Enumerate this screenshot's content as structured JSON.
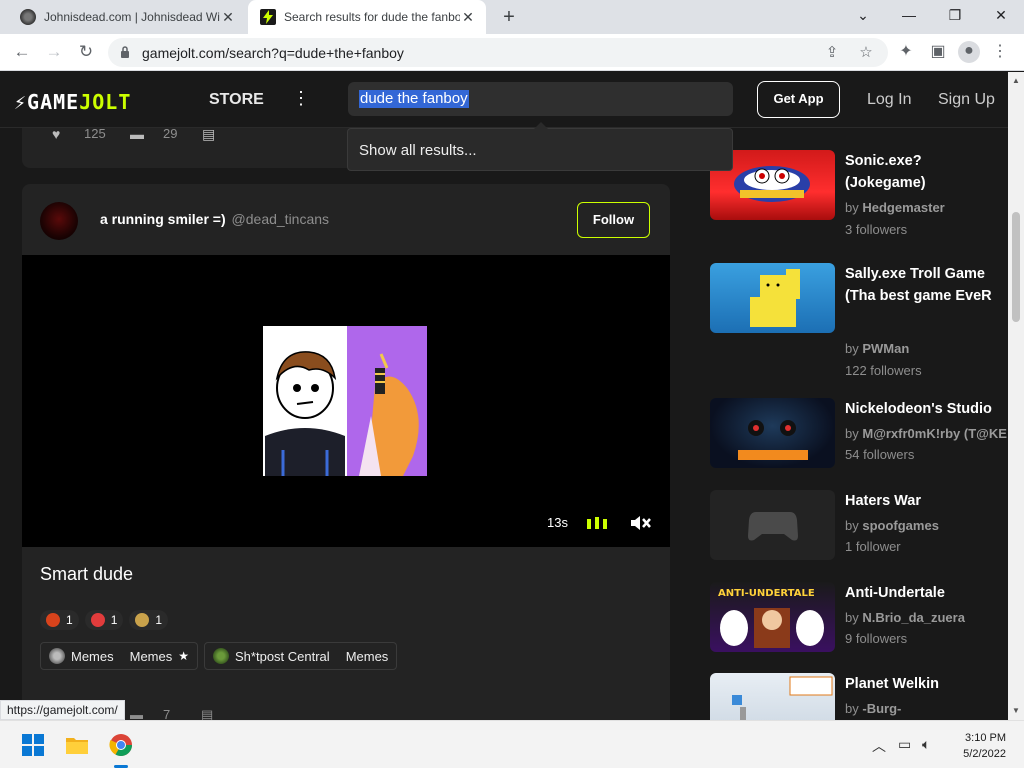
{
  "browser": {
    "tabs": [
      {
        "title": "Johnisdead.com | Johnisdead Wi",
        "active": false
      },
      {
        "title": "Search results for dude the fanbo",
        "active": true
      }
    ],
    "url": "gamejolt.com/search?q=dude+the+fanboy",
    "status_url": "https://gamejolt.com/"
  },
  "header": {
    "logo_left": "GAME",
    "logo_right": "JOLT",
    "store": "STORE",
    "search_query": "dude the fanboy",
    "get_app": "Get App",
    "login": "Log In",
    "signup": "Sign Up"
  },
  "dropdown": {
    "item": "Show all results..."
  },
  "feed": {
    "prev_post": {
      "likes": "125",
      "comments": "29"
    },
    "post": {
      "author": "a running smiler =)",
      "handle": "@dead_tincans",
      "follow": "Follow",
      "video_time": "13s",
      "title": "Smart dude",
      "reactions": [
        {
          "count": "1",
          "color": "#d8431c"
        },
        {
          "count": "1",
          "color": "#e23c3c"
        },
        {
          "count": "1",
          "color": "#c9a24b"
        }
      ],
      "chips": [
        {
          "label": "Memes",
          "sub": "Memes",
          "starred": true
        },
        {
          "label": "Sh*tpost Central",
          "sub": "Memes",
          "starred": false
        }
      ],
      "comments": "7"
    }
  },
  "games": [
    {
      "title": "Sonic.exe? (Jokegame)",
      "by_prefix": "by",
      "author": "Hedgemaster",
      "followers": "3 followers"
    },
    {
      "title": "Sally.exe Troll Game (Tha best game EveR",
      "by_prefix": "by",
      "author": "PWMan",
      "followers": "122 followers"
    },
    {
      "title": "Nickelodeon's Studio",
      "by_prefix": "by",
      "author": "M@rxfr0mK!rby (T@KE",
      "followers": "54 followers"
    },
    {
      "title": "Haters War",
      "by_prefix": "by",
      "author": "spoofgames",
      "followers": "1 follower"
    },
    {
      "title": "Anti-Undertale",
      "by_prefix": "by",
      "author": "N.Brio_da_zuera",
      "followers": "9 followers"
    },
    {
      "title": "Planet Welkin",
      "by_prefix": "by",
      "author": "-Burg-",
      "followers": ""
    }
  ],
  "taskbar": {
    "time": "3:10 PM",
    "date": "5/2/2022"
  }
}
